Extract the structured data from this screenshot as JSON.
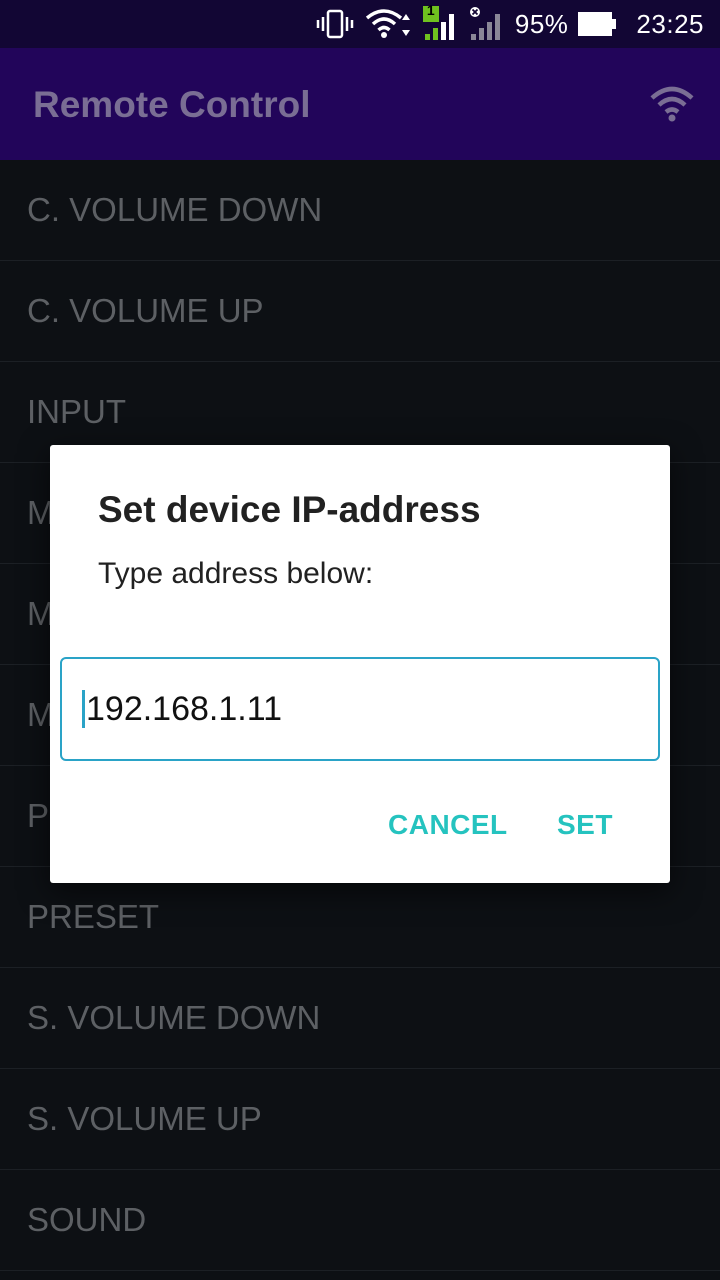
{
  "status_bar": {
    "battery_percent": "95%",
    "time": "23:25",
    "sim_badge": "1",
    "icons": [
      "vibrate-icon",
      "wifi-icon",
      "signal-icon",
      "signal-x-icon",
      "battery-icon"
    ]
  },
  "app_bar": {
    "title": "Remote Control",
    "action_icon": "wifi-icon"
  },
  "list": {
    "items": [
      {
        "label": "C. VOLUME DOWN"
      },
      {
        "label": "C. VOLUME UP"
      },
      {
        "label": "INPUT"
      },
      {
        "label": "M"
      },
      {
        "label": "M"
      },
      {
        "label": "M"
      },
      {
        "label": "P"
      },
      {
        "label": "PRESET"
      },
      {
        "label": "S. VOLUME DOWN"
      },
      {
        "label": "S. VOLUME UP"
      },
      {
        "label": "SOUND"
      }
    ]
  },
  "dialog": {
    "title": "Set device IP-address",
    "message": "Type address below:",
    "input_value": "192.168.1.11",
    "cancel_label": "CANCEL",
    "set_label": "SET"
  },
  "colors": {
    "status_bar_bg": "#120634",
    "app_bar_bg": "#22055a",
    "list_bg": "#0d1014",
    "accent": "#25c3bf",
    "input_border": "#2aa3c7"
  }
}
